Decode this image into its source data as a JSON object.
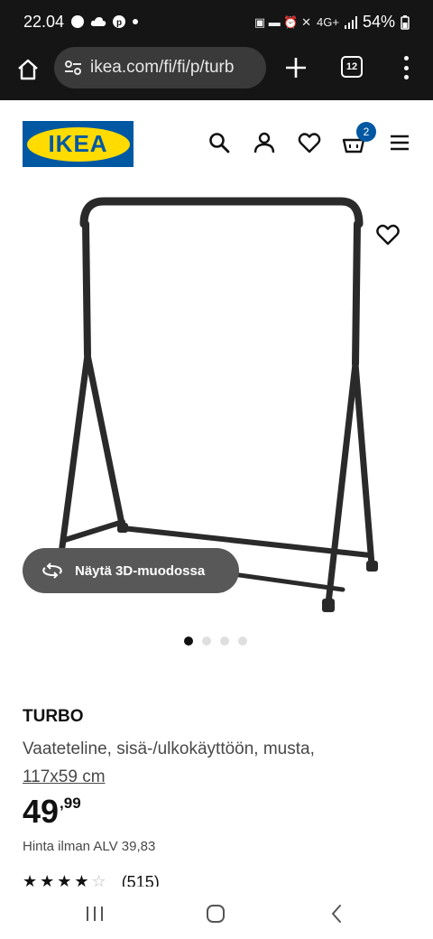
{
  "status_bar": {
    "time": "22.04",
    "battery": "54%",
    "network": "4G+"
  },
  "browser": {
    "url": "ikea.com/fi/fi/p/turb",
    "tab_count": "12"
  },
  "header": {
    "logo_text": "IKEA",
    "cart_count": "2"
  },
  "product": {
    "view_3d_label": "Näytä 3D-muodossa",
    "image_count": 4,
    "active_image": 1,
    "name": "TURBO",
    "description": "Vaateteline, sisä-/ulkokäyttöön, musta,",
    "size": "117x59 cm",
    "price_integer": "49",
    "price_decimal": ",99",
    "price_without_vat": "Hinta ilman ALV 39,83",
    "rating_stars": 4,
    "rating_count": "(515)"
  },
  "colors": {
    "ikea_blue": "#0058a3",
    "ikea_yellow": "#ffdb00",
    "status_bg": "#151515",
    "pill_bg": "#585858"
  }
}
